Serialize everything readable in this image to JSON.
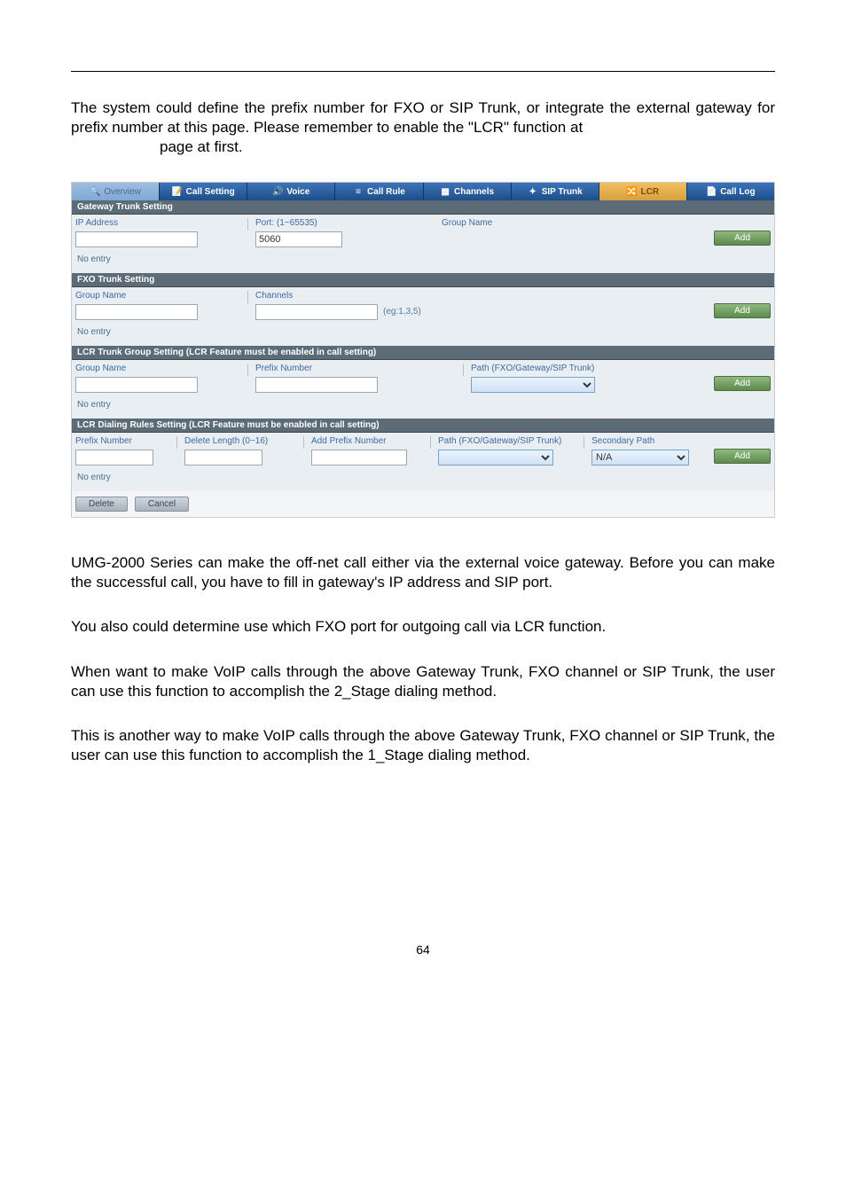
{
  "document": {
    "paragraphs": {
      "intro1": "The system could define the prefix number for FXO or SIP Trunk, or integrate the external gateway for prefix number at this page. Please remember to enable the \"LCR\" function at",
      "intro2": "page at first.",
      "p2": "UMG-2000 Series can make the off-net call either via the external voice gateway. Before you can make the successful call, you have to fill in gateway's IP address and SIP port.",
      "p3": "You also could determine use which FXO port for outgoing call via LCR function.",
      "p4": "When want to make VoIP calls through the above Gateway Trunk, FXO channel or SIP Trunk, the user can use this function to accomplish the 2_Stage dialing method.",
      "p5": "This is another way to make VoIP calls through the above Gateway Trunk, FXO channel or SIP Trunk, the user can use this function to accomplish the 1_Stage dialing method."
    },
    "page_number": "64"
  },
  "screenshot": {
    "tabs": {
      "overview": "Overview",
      "call_setting": "Call Setting",
      "voice": "Voice",
      "call_rule": "Call Rule",
      "channels": "Channels",
      "sip_trunk": "SIP Trunk",
      "lcr": "LCR",
      "call_log": "Call Log"
    },
    "gateway_trunk": {
      "title": "Gateway Trunk Setting",
      "ip_label": "IP Address",
      "port_label": "Port: (1~65535)",
      "port_value": "5060",
      "group_label": "Group Name",
      "add": "Add",
      "noentry": "No entry"
    },
    "fxo_trunk": {
      "title": "FXO Trunk Setting",
      "group_label": "Group Name",
      "channels_label": "Channels",
      "channels_hint": "(eg:1,3,5)",
      "add": "Add",
      "noentry": "No entry"
    },
    "lcr_group": {
      "title": "LCR Trunk Group Setting  (LCR Feature must be enabled in call setting)",
      "group_label": "Group Name",
      "prefix_label": "Prefix Number",
      "path_label": "Path (FXO/Gateway/SIP Trunk)",
      "add": "Add",
      "noentry": "No entry"
    },
    "lcr_dial": {
      "title": "LCR Dialing Rules Setting  (LCR Feature must be enabled in call setting)",
      "prefix_label": "Prefix Number",
      "delete_len_label": "Delete Length (0~16)",
      "add_prefix_label": "Add Prefix Number",
      "path_label": "Path (FXO/Gateway/SIP Trunk)",
      "secondary_label": "Secondary Path",
      "secondary_value": "N/A",
      "add": "Add",
      "noentry": "No entry"
    },
    "buttons": {
      "delete": "Delete",
      "cancel": "Cancel"
    }
  }
}
